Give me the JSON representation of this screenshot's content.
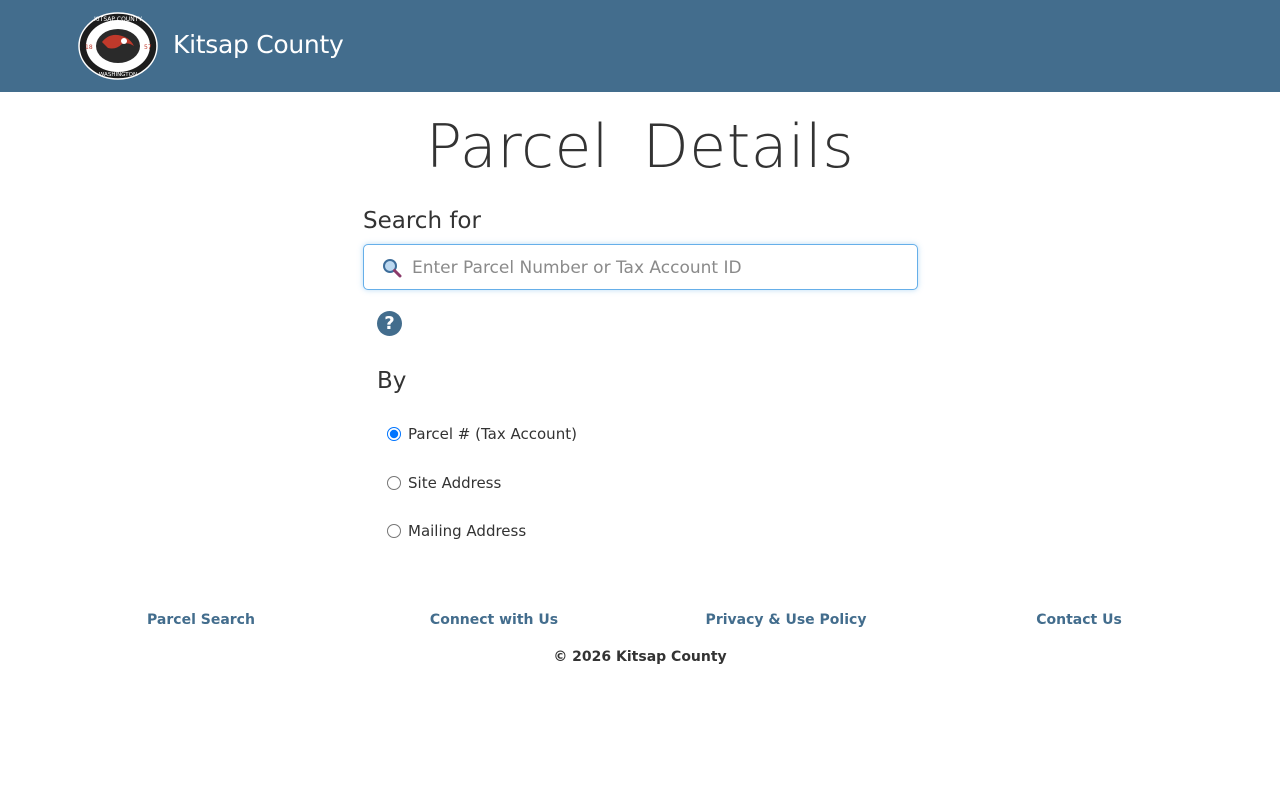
{
  "header": {
    "site_title": "Kitsap County",
    "logo": {
      "top_text": "KITSAP COUNTY",
      "bottom_text": "WASHINGTON",
      "left_num": "18",
      "right_num": "57"
    },
    "background_color": "#436d8d"
  },
  "main": {
    "page_title": "Parcel  Details",
    "search_label": "Search for",
    "search": {
      "placeholder": "Enter Parcel Number or Tax Account ID",
      "value": "",
      "icon": "search-icon"
    },
    "help_icon": "?",
    "by_label": "By",
    "options": [
      {
        "label": "Parcel # (Tax Account)",
        "checked": true
      },
      {
        "label": "Site Address",
        "checked": false
      },
      {
        "label": "Mailing Address",
        "checked": false
      }
    ]
  },
  "footer": {
    "links": [
      {
        "label": "Parcel Search"
      },
      {
        "label": "Connect with Us"
      },
      {
        "label": "Privacy & Use Policy"
      },
      {
        "label": "Contact Us"
      }
    ],
    "copyright": "© 2026 Kitsap County"
  }
}
